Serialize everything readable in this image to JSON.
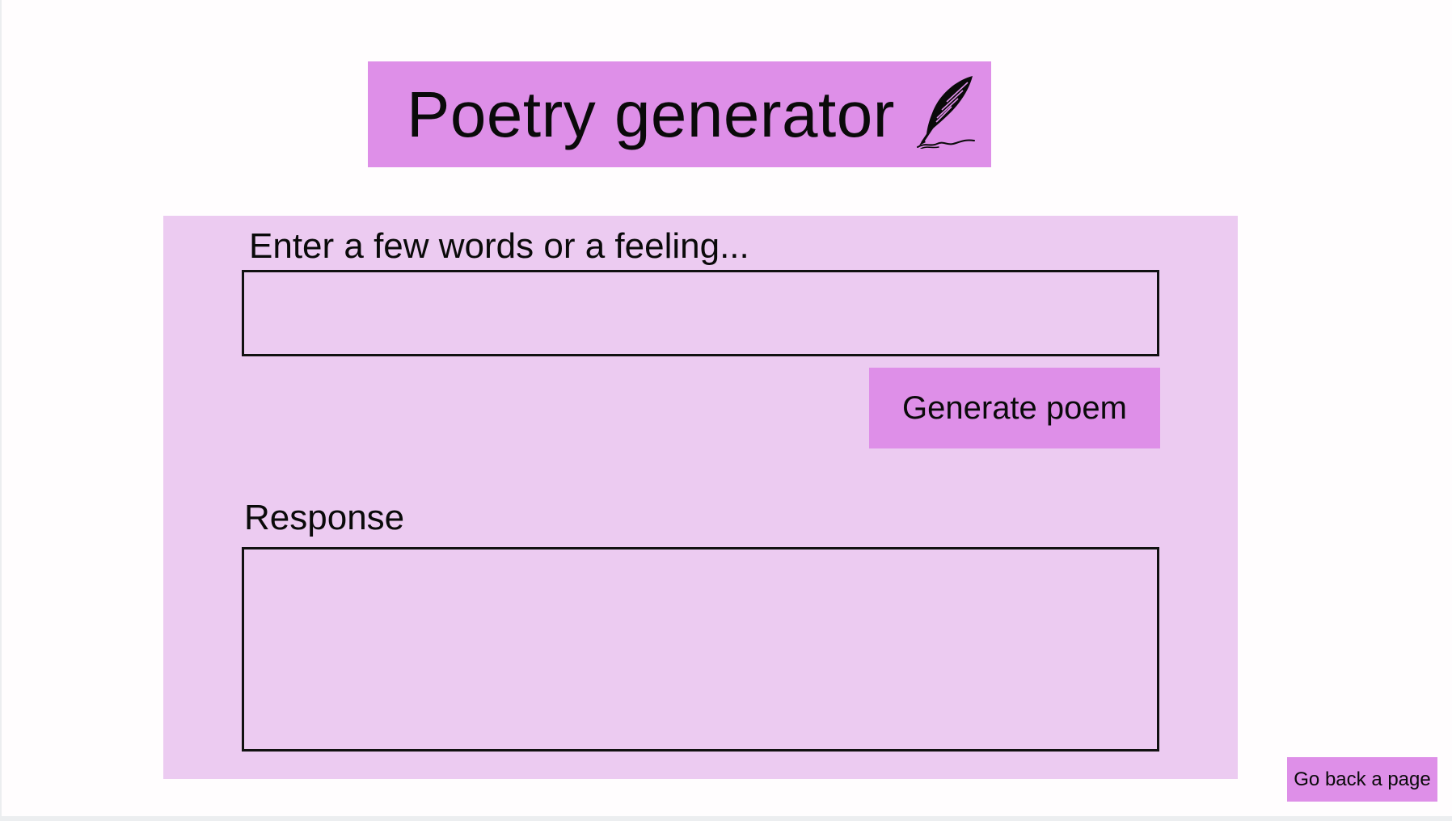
{
  "header": {
    "title": "Poetry generator",
    "title_icon": "quill-pen-icon",
    "banner_color": "#de8fe8"
  },
  "form": {
    "prompt_label": "Enter a few words or a feeling...",
    "prompt_value": "",
    "prompt_placeholder": "",
    "generate_label": "Generate poem",
    "panel_color": "#eccbf1"
  },
  "response": {
    "label": "Response",
    "text": ""
  },
  "nav": {
    "back_label": "Go back a page"
  }
}
